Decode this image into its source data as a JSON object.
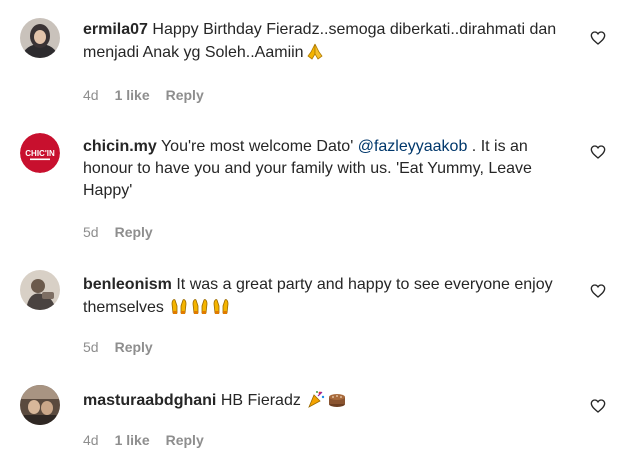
{
  "comments": [
    {
      "username": "ermila07",
      "text": "Happy Birthday Fieradz..semoga diberkati..dirahmati dan menjadi Anak yg Soleh..Aamiin",
      "emoji_icons": [
        "praying-hands-icon"
      ],
      "time": "4d",
      "likes": "1 like",
      "reply": "Reply"
    },
    {
      "username": "chicin.my",
      "text_before": "You're most welcome Dato'",
      "mention": "@fazleyyaakob",
      "text_after": ". It is an honour to have you and your family with us. 'Eat Yummy, Leave Happy'",
      "avatar_text": "CHIC'IN",
      "time": "5d",
      "reply": "Reply"
    },
    {
      "username": "benleonism",
      "text": "It was a great party and happy to see everyone enjoy themselves",
      "emoji_icons": [
        "raising-hands-icon",
        "raising-hands-icon",
        "raising-hands-icon"
      ],
      "time": "5d",
      "reply": "Reply"
    },
    {
      "username": "masturaabdghani",
      "text": "HB Fieradz",
      "emoji_icons": [
        "party-popper-icon",
        "cake-icon"
      ],
      "time": "4d",
      "likes": "1 like",
      "reply": "Reply"
    }
  ],
  "colors": {
    "text": "#262626",
    "meta": "#8e8e8e",
    "mention": "#00376b",
    "brand_red": "#c8102e"
  }
}
